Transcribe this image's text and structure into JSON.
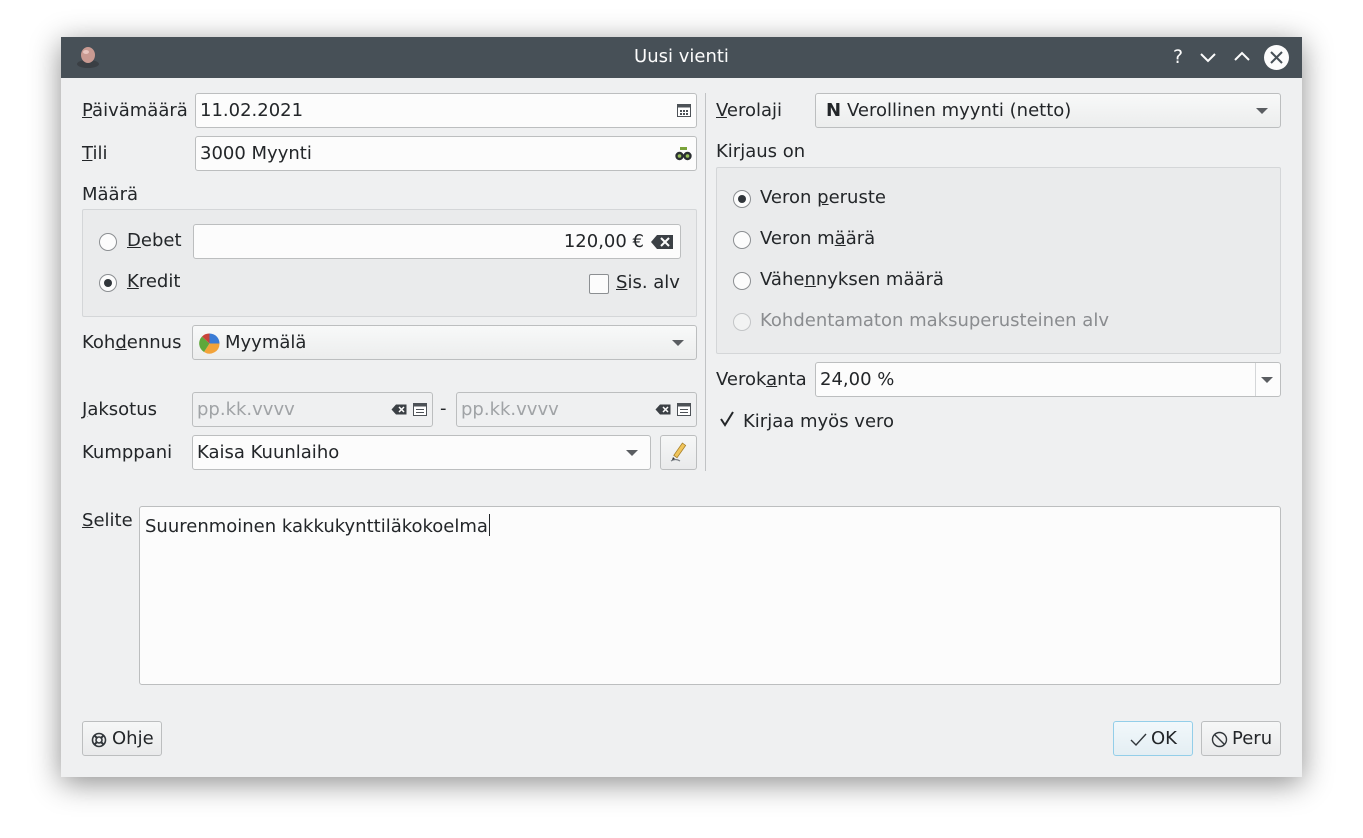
{
  "window": {
    "title": "Uusi vienti",
    "help_glyph": "?",
    "minimize_glyph": "⌄",
    "maximize_glyph": "⌃"
  },
  "left": {
    "date": {
      "label_ul": "P",
      "label_rest": "äivämäärä",
      "value": "11.02.2021"
    },
    "account": {
      "label_ul": "T",
      "label_rest": "ili",
      "value": "3000 Myynti"
    },
    "amount_label": "Määrä",
    "debit": {
      "label_ul": "D",
      "label_rest": "ebet",
      "selected": false
    },
    "credit": {
      "label_ul": "K",
      "label_rest": "redit",
      "selected": true
    },
    "amount_value": "120,00 €",
    "incl_vat": {
      "label_ul": "S",
      "label_rest": "is. alv",
      "checked": false
    },
    "allocation": {
      "label_pre": "Koh",
      "label_ul": "d",
      "label_post": "ennus",
      "value": "Myymälä"
    },
    "period": {
      "label_ul": "J",
      "label_rest": "aksotus",
      "from_placeholder": "pp.kk.vvvv",
      "separator": "-",
      "to_placeholder": "pp.kk.vvvv"
    },
    "partner": {
      "label": "Kumppani",
      "value": "Kaisa Kuunlaiho"
    }
  },
  "right": {
    "tax_type": {
      "label_ul": "V",
      "label_rest": "erolaji",
      "code": "N",
      "value": "Verollinen myynti (netto)"
    },
    "entry_is_label": "Kirjaus on",
    "options": [
      {
        "pre": "Veron ",
        "ul": "p",
        "post": "eruste",
        "selected": true,
        "disabled": false
      },
      {
        "pre": "Veron m",
        "ul": "ä",
        "post": "ärä",
        "selected": false,
        "disabled": false
      },
      {
        "pre": "Vähe",
        "ul": "n",
        "post": "nyksen määrä",
        "selected": false,
        "disabled": false
      },
      {
        "pre": "Kohdentamaton maksuperusteinen alv",
        "ul": "",
        "post": "",
        "selected": false,
        "disabled": true
      }
    ],
    "tax_rate": {
      "label_pre": "Verok",
      "label_ul": "a",
      "label_post": "nta",
      "value": "24,00 %"
    },
    "also_post_tax": {
      "label": "Kirjaa myös vero",
      "checked": true
    }
  },
  "description": {
    "label_ul": "S",
    "label_rest": "elite",
    "value": "Suurenmoinen kakkukynttiläkokoelma"
  },
  "buttons": {
    "help": "Ohje",
    "ok": "OK",
    "cancel": "Peru"
  },
  "colors": {
    "titlebar": "#475057",
    "window_bg": "#eff0f1",
    "field_bg": "#fcfcfc",
    "default_button_border": "#93cee9"
  }
}
